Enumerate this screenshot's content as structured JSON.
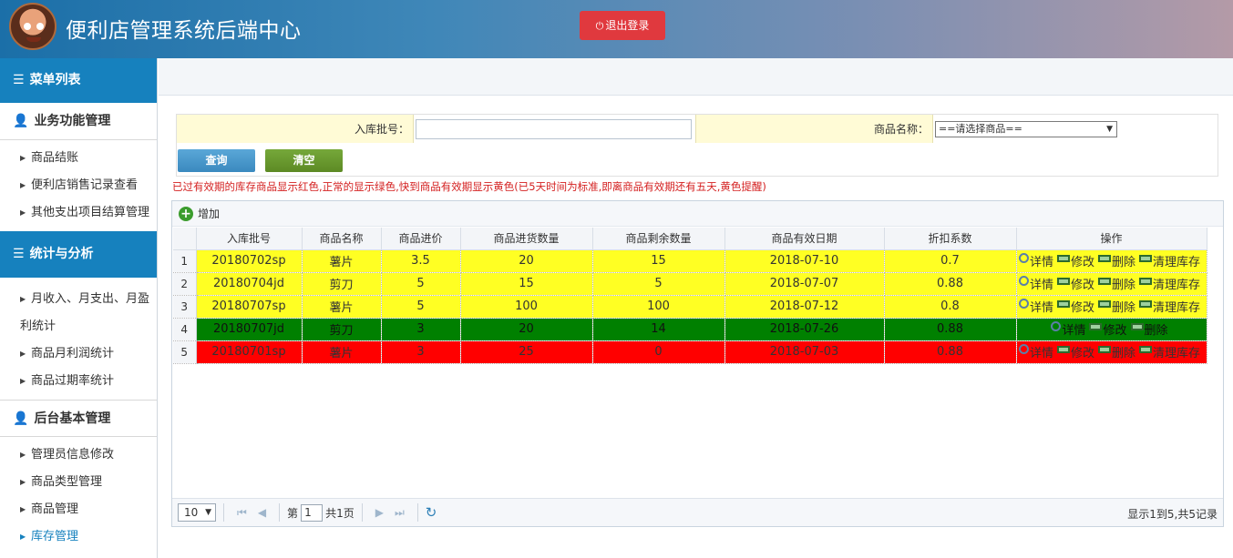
{
  "header": {
    "title": "便利店管理系统后端中心",
    "logout_label": "退出登录"
  },
  "sidebar": {
    "menu_title": "菜单列表",
    "groups": [
      {
        "label": "业务功能管理",
        "items": [
          "商品结账",
          "便利店销售记录查看",
          "其他支出项目结算管理"
        ]
      },
      {
        "label": "统计与分析",
        "items": [
          "月收入、月支出、月盈",
          "利统计",
          "商品月利润统计",
          "商品过期率统计"
        ]
      },
      {
        "label": "后台基本管理",
        "items": [
          "管理员信息修改",
          "商品类型管理",
          "商品管理",
          "库存管理"
        ]
      }
    ]
  },
  "search": {
    "batch_label": "入库批号：",
    "batch_value": "",
    "product_label": "商品名称：",
    "product_selected": "==请选择商品==",
    "query_label": "查询",
    "clear_label": "清空"
  },
  "hint": "已过有效期的库存商品显示红色,正常的显示绿色,快到商品有效期显示黄色(已5天时间为标准,即离商品有效期还有五天,黄色提醒)",
  "grid": {
    "add_label": "增加",
    "columns": [
      "入库批号",
      "商品名称",
      "商品进价",
      "商品进货数量",
      "商品剩余数量",
      "商品有效日期",
      "折扣系数",
      "操作"
    ],
    "rows": [
      {
        "n": "1",
        "batch": "20180702sp",
        "name": "薯片",
        "price": "3.5",
        "qty": "20",
        "left": "15",
        "date": "2018-07-10",
        "discount": "0.7",
        "status": "yellow"
      },
      {
        "n": "2",
        "batch": "20180704jd",
        "name": "剪刀",
        "price": "5",
        "qty": "15",
        "left": "5",
        "date": "2018-07-07",
        "discount": "0.88",
        "status": "yellow"
      },
      {
        "n": "3",
        "batch": "20180707sp",
        "name": "薯片",
        "price": "5",
        "qty": "100",
        "left": "100",
        "date": "2018-07-12",
        "discount": "0.8",
        "status": "yellow"
      },
      {
        "n": "4",
        "batch": "20180707jd",
        "name": "剪刀",
        "price": "3",
        "qty": "20",
        "left": "14",
        "date": "2018-07-26",
        "discount": "0.88",
        "status": "green"
      },
      {
        "n": "5",
        "batch": "20180701sp",
        "name": "薯片",
        "price": "3",
        "qty": "25",
        "left": "0",
        "date": "2018-07-03",
        "discount": "0.88",
        "status": "red"
      }
    ],
    "ops": {
      "detail": "详情",
      "edit": "修改",
      "delete": "删除",
      "clear_stock": "清理库存"
    }
  },
  "pager": {
    "page_size": "10",
    "page_prefix": "第",
    "page_value": "1",
    "page_total": "共1页",
    "info": "显示1到5,共5记录"
  },
  "colors": {
    "header_blue": "#1681be",
    "logout_red": "#e0393e",
    "row_yellow": "#ffff23",
    "row_green": "#008000",
    "row_red": "#ff0000",
    "hint_red": "#d42020"
  }
}
